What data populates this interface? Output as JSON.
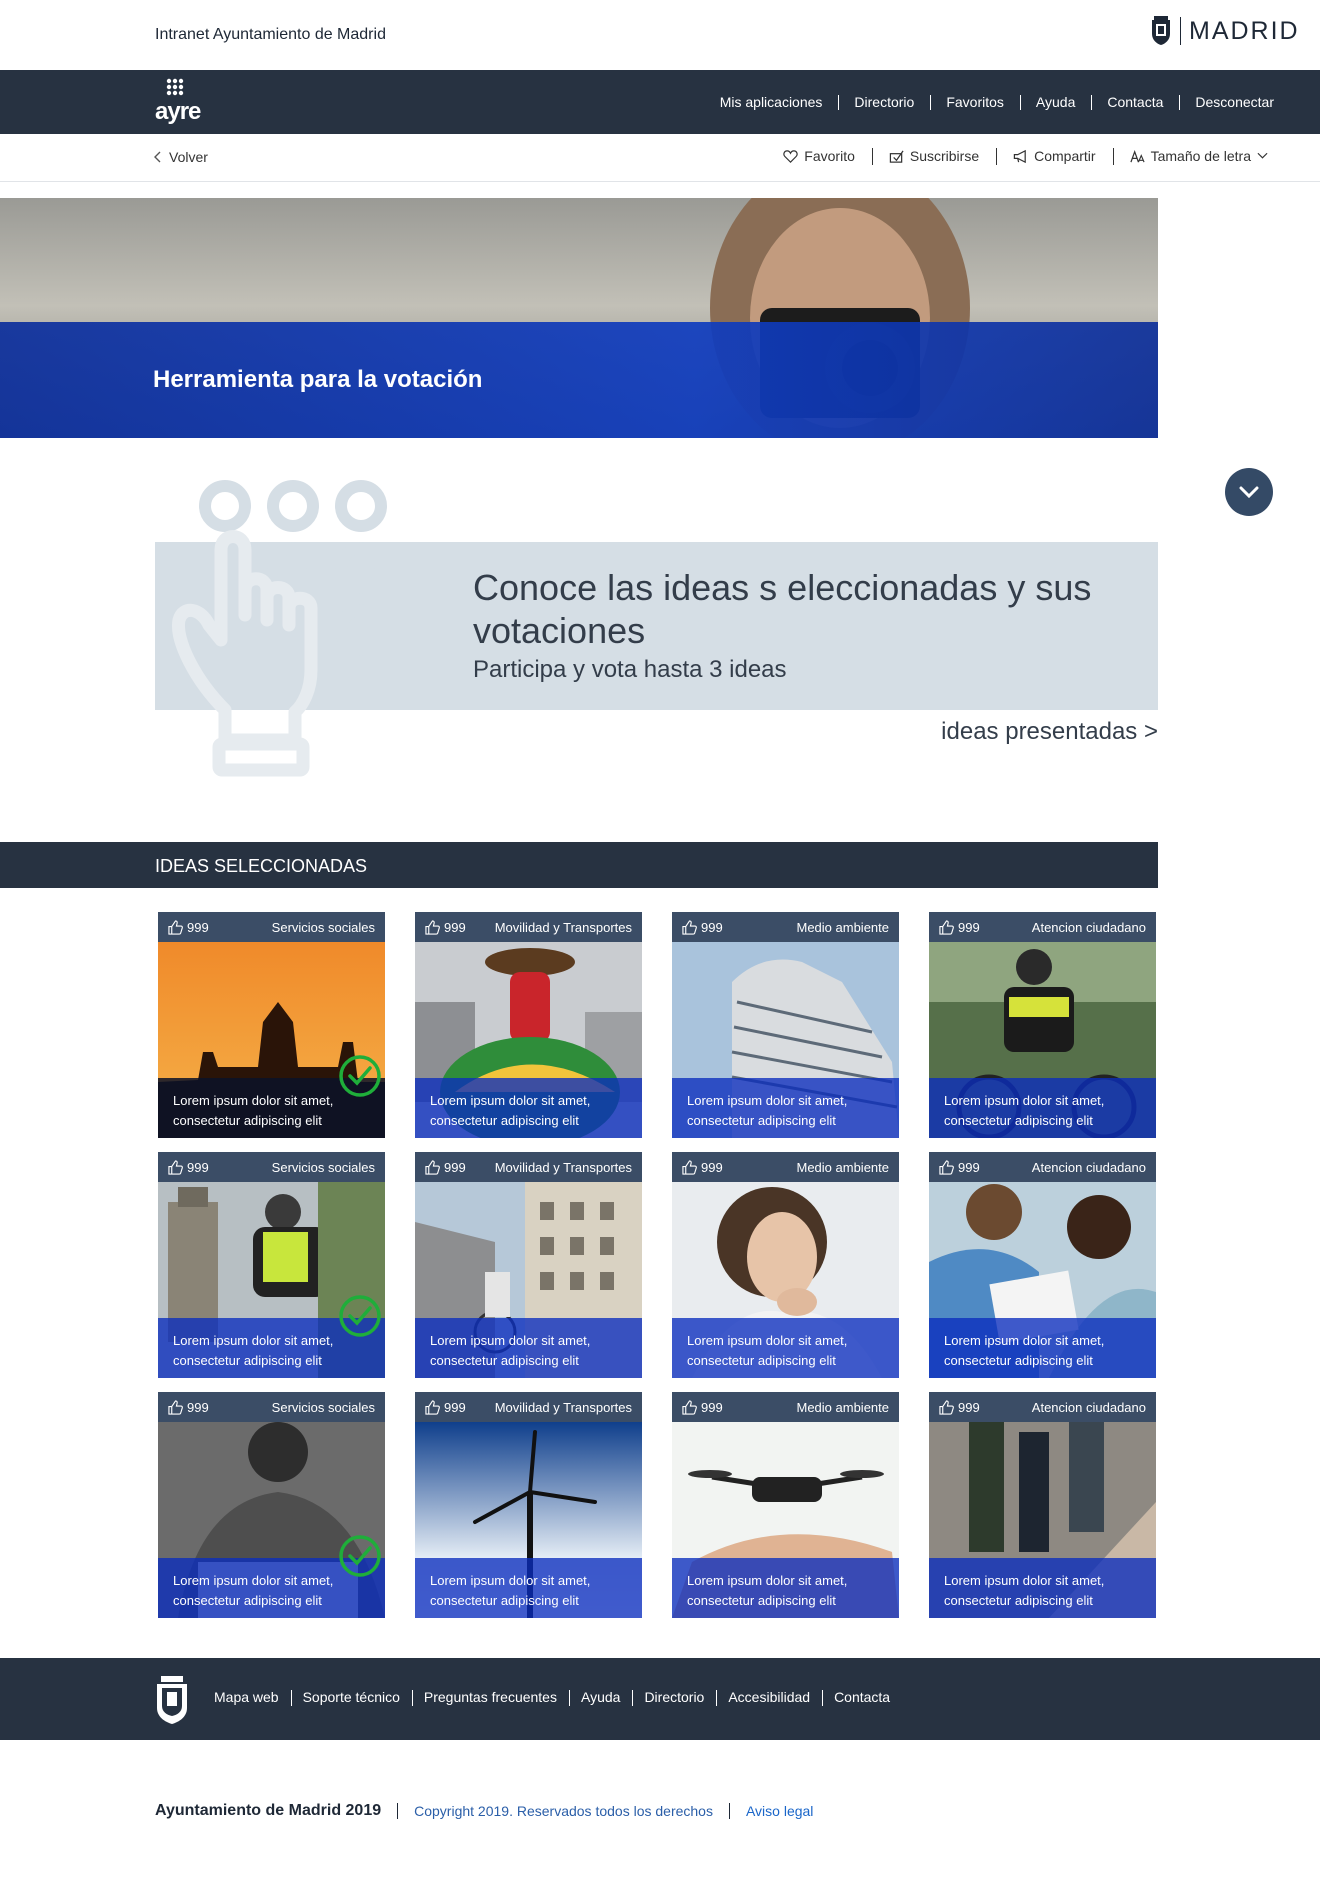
{
  "header": {
    "site_title": "Intranet Ayuntamiento de Madrid",
    "brand": "MADRID"
  },
  "nav": {
    "logo_text": "ayre",
    "items": [
      {
        "label": "Mis aplicaciones"
      },
      {
        "label": "Directorio"
      },
      {
        "label": "Favoritos"
      },
      {
        "label": "Ayuda"
      },
      {
        "label": "Contacta"
      },
      {
        "label": "Desconectar"
      }
    ]
  },
  "toolbar": {
    "back": "Volver",
    "tools": [
      {
        "label": "Favorito",
        "icon": "heart-icon"
      },
      {
        "label": "Suscribirse",
        "icon": "subscribe-icon"
      },
      {
        "label": "Compartir",
        "icon": "megaphone-icon"
      },
      {
        "label": "Tamaño de letra",
        "icon": "font-size-icon"
      }
    ]
  },
  "hero": {
    "title": "Herramienta para la votación"
  },
  "intro": {
    "title": "Conoce las ideas s eleccionadas y sus votaciones",
    "subtitle": "Participa y vota hasta 3 ideas",
    "link": "ideas presentadas >"
  },
  "section": {
    "title": "IDEAS SELECCIONADAS"
  },
  "cards": [
    {
      "votes": "999",
      "category": "Servicios sociales",
      "caption": "Lorem ipsum dolor sit amet, consectetur adipiscing elit",
      "selected": true,
      "image": "sunset-palace"
    },
    {
      "votes": "999",
      "category": "Movilidad y Transportes",
      "caption": "Lorem ipsum dolor sit amet, consectetur adipiscing elit",
      "selected": false,
      "image": "statue-square"
    },
    {
      "votes": "999",
      "category": "Medio ambiente",
      "caption": "Lorem ipsum dolor sit amet, consectetur adipiscing elit",
      "selected": false,
      "image": "building"
    },
    {
      "votes": "999",
      "category": "Atencion ciudadano",
      "caption": "Lorem ipsum dolor sit amet, consectetur adipiscing elit",
      "selected": false,
      "image": "police-cyclist"
    },
    {
      "votes": "999",
      "category": "Servicios sociales",
      "caption": "Lorem ipsum dolor sit amet, consectetur adipiscing elit",
      "selected": true,
      "image": "cyclist-monument"
    },
    {
      "votes": "999",
      "category": "Movilidad y Transportes",
      "caption": "Lorem ipsum dolor sit amet, consectetur adipiscing elit",
      "selected": false,
      "image": "street-bike"
    },
    {
      "votes": "999",
      "category": "Medio ambiente",
      "caption": "Lorem ipsum dolor sit amet, consectetur adipiscing elit",
      "selected": false,
      "image": "woman-thinking"
    },
    {
      "votes": "999",
      "category": "Atencion ciudadano",
      "caption": "Lorem ipsum dolor sit amet, consectetur adipiscing elit",
      "selected": false,
      "image": "couple-document"
    },
    {
      "votes": "999",
      "category": "Servicios sociales",
      "caption": "Lorem ipsum dolor sit amet, consectetur adipiscing elit",
      "selected": true,
      "image": "man-writing"
    },
    {
      "votes": "999",
      "category": "Movilidad y Transportes",
      "caption": "Lorem ipsum dolor sit amet, consectetur adipiscing elit",
      "selected": false,
      "image": "wind-turbine"
    },
    {
      "votes": "999",
      "category": "Medio ambiente",
      "caption": "Lorem ipsum dolor sit amet, consectetur adipiscing elit",
      "selected": false,
      "image": "drone"
    },
    {
      "votes": "999",
      "category": "Atencion ciudadano",
      "caption": "Lorem ipsum dolor sit amet, consectetur adipiscing elit",
      "selected": false,
      "image": "street-walkers"
    }
  ],
  "footer": {
    "links": [
      {
        "label": "Mapa web"
      },
      {
        "label": "Soporte técnico"
      },
      {
        "label": "Preguntas frecuentes"
      },
      {
        "label": "Ayuda"
      },
      {
        "label": "Directorio"
      },
      {
        "label": "Accesibilidad"
      },
      {
        "label": "Contacta"
      }
    ],
    "org": "Ayuntamiento de Madrid 2019",
    "copyright": "Copyright 2019. Reservados todos los derechos",
    "legal": "Aviso legal"
  },
  "colors": {
    "navy": "#273241",
    "card_bar": "#3b4d66",
    "blue_overlay": "#0a2dbe",
    "intro_panel": "#d5dee5",
    "check_green": "#1fae3a",
    "link_blue": "#1a66c9"
  }
}
